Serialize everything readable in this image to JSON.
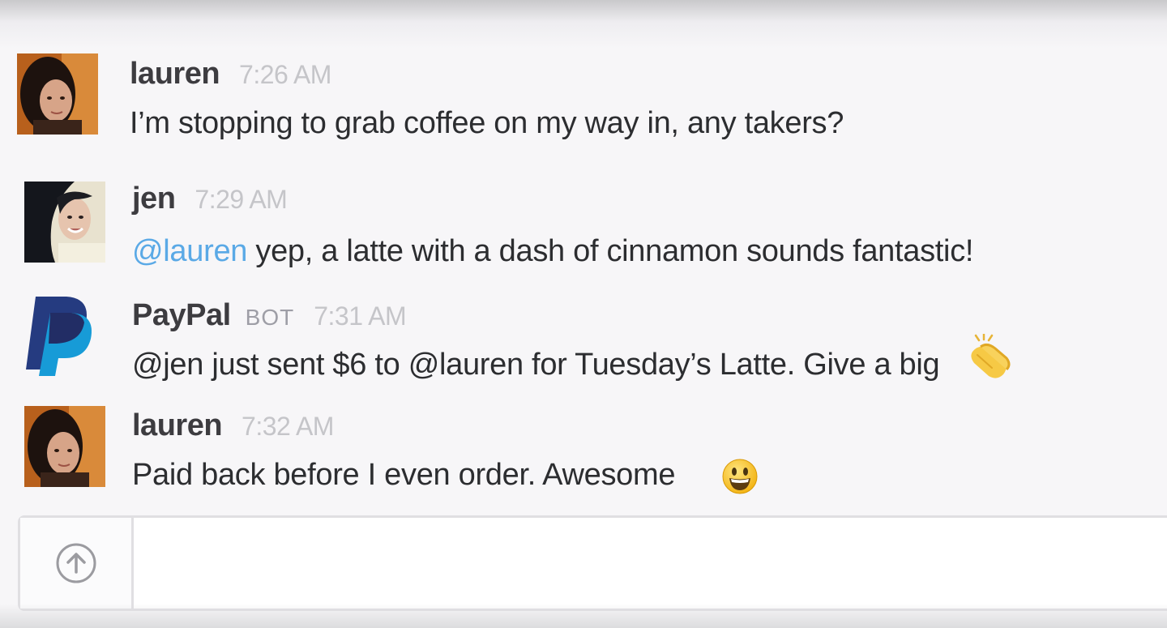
{
  "messages": [
    {
      "author": "lauren",
      "time": "7:26 AM",
      "text": "I’m stopping to grab coffee on my way in, any takers?",
      "avatar": "lauren-avatar"
    },
    {
      "author": "jen",
      "time": "7:29 AM",
      "mention": "@lauren",
      "text": " yep, a latte with a dash of cinnamon sounds fantastic!",
      "avatar": "jen-avatar"
    },
    {
      "author": "PayPal",
      "badge": "BOT",
      "time": "7:31 AM",
      "text": "@jen just sent $6 to @lauren for Tuesday’s Latte. Give a big",
      "emoji": "clapping-hands",
      "avatar": "paypal-logo"
    },
    {
      "author": "lauren",
      "time": "7:32 AM",
      "text": "Paid back before I even order.  Awesome",
      "emoji": "smiley",
      "avatar": "lauren-avatar"
    }
  ],
  "composer": {
    "placeholder": "",
    "upload_icon": "upload-arrow-icon"
  },
  "colors": {
    "mention": "#5aa9e6",
    "paypal_dark": "#253b80",
    "paypal_light": "#179bd7",
    "timestamp": "#c5c5c9"
  }
}
